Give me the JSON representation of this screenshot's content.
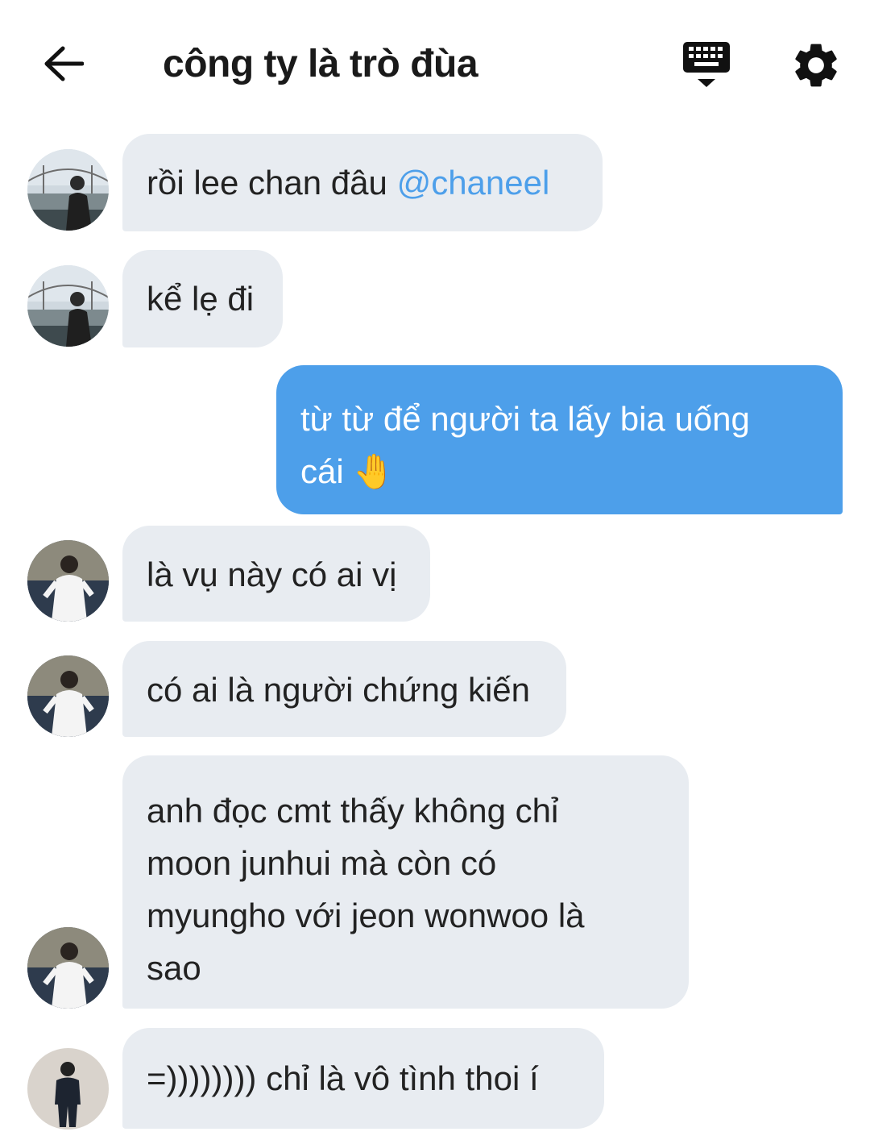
{
  "header": {
    "title": "công ty là trò đùa"
  },
  "messages": [
    {
      "text": "rồi lee chan đâu ",
      "mention": "@chaneel"
    },
    {
      "text": "kể lẹ đi"
    },
    {
      "text": "từ từ để người ta lấy bia uống\ncái 🤚"
    },
    {
      "text": "là vụ này có ai vị"
    },
    {
      "text": "có ai là người chứng kiến"
    },
    {
      "text": "anh đọc cmt thấy không chỉ\nmoon junhui mà còn có\nmyungho với jeon wonwoo là\nsao"
    },
    {
      "text": "=)))))))) chỉ là vô tình thoi í"
    }
  ],
  "colors": {
    "incoming_bubble": "#e8ecf1",
    "outgoing_bubble": "#4d9fea",
    "mention": "#4d9fea"
  },
  "icons": [
    "back-arrow-icon",
    "keyboard-icon",
    "gear-icon"
  ]
}
